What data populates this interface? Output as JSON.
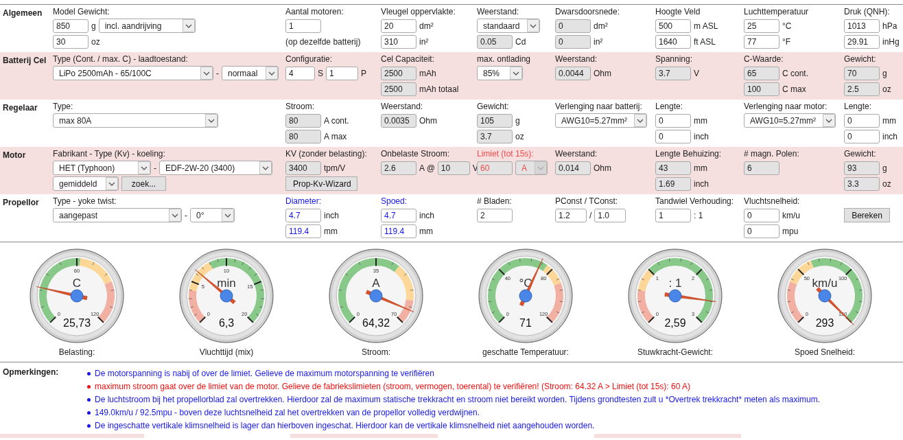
{
  "rows": [
    {
      "title": "Algemeen",
      "highlight": false,
      "cells": [
        {
          "kind": "plain",
          "label": "Model Gewicht:",
          "lines": [
            [
              {
                "kind": "input",
                "value": "850",
                "readonly": false
              },
              {
                "kind": "text",
                "text": "g"
              },
              {
                "kind": "select",
                "value": "incl. aandrijving",
                "disabled": false
              }
            ],
            [
              {
                "kind": "input",
                "value": "30",
                "readonly": false
              },
              {
                "kind": "text",
                "text": "oz"
              }
            ]
          ]
        },
        {
          "kind": "plain",
          "label": "Aantal motoren:",
          "lines": [
            [
              {
                "kind": "input",
                "value": "1",
                "readonly": false
              }
            ],
            [
              {
                "kind": "note",
                "text": "(op dezelfde batterij)"
              }
            ]
          ]
        },
        {
          "kind": "plain",
          "label": "Vleugel oppervlakte:",
          "lines": [
            [
              {
                "kind": "input",
                "value": "20",
                "readonly": false
              },
              {
                "kind": "text",
                "text": "dm²"
              }
            ],
            [
              {
                "kind": "input",
                "value": "310",
                "readonly": false
              },
              {
                "kind": "text",
                "text": "in²"
              }
            ]
          ]
        },
        {
          "kind": "plain",
          "label": "Weerstand:",
          "lines": [
            [
              {
                "kind": "select",
                "value": "standaard",
                "disabled": false
              }
            ],
            [
              {
                "kind": "input",
                "value": "0.05",
                "readonly": true
              },
              {
                "kind": "text",
                "text": "Cd"
              }
            ]
          ]
        },
        {
          "kind": "plain",
          "label": "Dwarsdoorsnede:",
          "lines": [
            [
              {
                "kind": "input",
                "value": "0",
                "readonly": true
              },
              {
                "kind": "text",
                "text": "dm²"
              }
            ],
            [
              {
                "kind": "input",
                "value": "0",
                "readonly": true
              },
              {
                "kind": "text",
                "text": "in²"
              }
            ]
          ]
        },
        {
          "kind": "plain",
          "label": "Hoogte Veld",
          "lines": [
            [
              {
                "kind": "input",
                "value": "500",
                "readonly": false
              },
              {
                "kind": "text",
                "text": "m ASL"
              }
            ],
            [
              {
                "kind": "input",
                "value": "1640",
                "readonly": false
              },
              {
                "kind": "text",
                "text": "ft ASL"
              }
            ]
          ]
        },
        {
          "kind": "plain",
          "label": "Luchttemperatuur",
          "lines": [
            [
              {
                "kind": "input",
                "value": "25",
                "readonly": false
              },
              {
                "kind": "text",
                "text": "°C"
              }
            ],
            [
              {
                "kind": "input",
                "value": "77",
                "readonly": false
              },
              {
                "kind": "text",
                "text": "°F"
              }
            ]
          ]
        },
        {
          "kind": "plain",
          "label": "Druk (QNH):",
          "lines": [
            [
              {
                "kind": "input",
                "value": "1013",
                "readonly": false
              },
              {
                "kind": "text",
                "text": "hPa"
              }
            ],
            [
              {
                "kind": "input",
                "value": "29.91",
                "readonly": false
              },
              {
                "kind": "text",
                "text": "inHg"
              }
            ]
          ]
        }
      ]
    },
    {
      "title": "Batterij Cel",
      "highlight": true,
      "cells": [
        {
          "kind": "plain",
          "label": "Type (Cont. / max. C) - laadtoestand:",
          "lines": [
            [
              {
                "kind": "select",
                "value": "LiPo 2500mAh - 65/100C",
                "disabled": false
              },
              {
                "kind": "text",
                "text": "-"
              },
              {
                "kind": "select",
                "value": "normaal",
                "disabled": false
              }
            ]
          ]
        },
        {
          "kind": "plain",
          "label": "Configuratie:",
          "lines": [
            [
              {
                "kind": "input",
                "value": "4",
                "readonly": false
              },
              {
                "kind": "text",
                "text": "S"
              },
              {
                "kind": "input",
                "value": "1",
                "readonly": false
              },
              {
                "kind": "text",
                "text": "P"
              }
            ]
          ]
        },
        {
          "kind": "plain",
          "label": "Cel Capaciteit:",
          "lines": [
            [
              {
                "kind": "input",
                "value": "2500",
                "readonly": true
              },
              {
                "kind": "text",
                "text": "mAh"
              }
            ],
            [
              {
                "kind": "input",
                "value": "2500",
                "readonly": true
              },
              {
                "kind": "text",
                "text": "mAh totaal"
              }
            ]
          ]
        },
        {
          "kind": "plain",
          "label": "max. ontlading",
          "lines": [
            [
              {
                "kind": "select",
                "value": "85%",
                "disabled": false
              }
            ]
          ]
        },
        {
          "kind": "plain",
          "label": "Weerstand:",
          "lines": [
            [
              {
                "kind": "input",
                "value": "0.0044",
                "readonly": true
              },
              {
                "kind": "text",
                "text": "Ohm"
              }
            ]
          ]
        },
        {
          "kind": "plain",
          "label": "Spanning:",
          "lines": [
            [
              {
                "kind": "input",
                "value": "3.7",
                "readonly": true
              },
              {
                "kind": "text",
                "text": "V"
              }
            ]
          ]
        },
        {
          "kind": "plain",
          "label": "C-Waarde:",
          "lines": [
            [
              {
                "kind": "input",
                "value": "65",
                "readonly": true
              },
              {
                "kind": "text",
                "text": "C cont."
              }
            ],
            [
              {
                "kind": "input",
                "value": "100",
                "readonly": true
              },
              {
                "kind": "text",
                "text": "C max"
              }
            ]
          ]
        },
        {
          "kind": "plain",
          "label": "Gewicht:",
          "lines": [
            [
              {
                "kind": "input",
                "value": "70",
                "readonly": true
              },
              {
                "kind": "text",
                "text": "g"
              }
            ],
            [
              {
                "kind": "input",
                "value": "2.5",
                "readonly": true
              },
              {
                "kind": "text",
                "text": "oz"
              }
            ]
          ]
        }
      ]
    },
    {
      "title": "Regelaar",
      "highlight": false,
      "cells": [
        {
          "kind": "plain",
          "label": "Type:",
          "lines": [
            [
              {
                "kind": "select",
                "value": "max 80A",
                "disabled": false
              }
            ]
          ]
        },
        {
          "kind": "plain",
          "label": "Stroom:",
          "lines": [
            [
              {
                "kind": "input",
                "value": "80",
                "readonly": true
              },
              {
                "kind": "text",
                "text": "A cont."
              }
            ],
            [
              {
                "kind": "input",
                "value": "80",
                "readonly": true
              },
              {
                "kind": "text",
                "text": "A max"
              }
            ]
          ]
        },
        {
          "kind": "plain",
          "label": "Weerstand:",
          "lines": [
            [
              {
                "kind": "input",
                "value": "0.0035",
                "readonly": true
              },
              {
                "kind": "text",
                "text": "Ohm"
              }
            ]
          ]
        },
        {
          "kind": "plain",
          "label": "Gewicht:",
          "lines": [
            [
              {
                "kind": "input",
                "value": "105",
                "readonly": true
              },
              {
                "kind": "text",
                "text": "g"
              }
            ],
            [
              {
                "kind": "input",
                "value": "3.7",
                "readonly": true
              },
              {
                "kind": "text",
                "text": "oz"
              }
            ]
          ]
        },
        {
          "kind": "plain",
          "label": "Verlenging naar batterij:",
          "lines": [
            [
              {
                "kind": "select",
                "value": "AWG10=5.27mm²",
                "disabled": false
              }
            ]
          ]
        },
        {
          "kind": "plain",
          "label": "Lengte:",
          "lines": [
            [
              {
                "kind": "input",
                "value": "0",
                "readonly": false
              },
              {
                "kind": "text",
                "text": "mm"
              }
            ],
            [
              {
                "kind": "input",
                "value": "0",
                "readonly": false
              },
              {
                "kind": "text",
                "text": "inch"
              }
            ]
          ]
        },
        {
          "kind": "plain",
          "label": "Verlenging naar motor:",
          "lines": [
            [
              {
                "kind": "select",
                "value": "AWG10=5.27mm²",
                "disabled": false
              }
            ]
          ]
        },
        {
          "kind": "plain",
          "label": "Lengte:",
          "lines": [
            [
              {
                "kind": "input",
                "value": "0",
                "readonly": false
              },
              {
                "kind": "text",
                "text": "mm"
              }
            ],
            [
              {
                "kind": "input",
                "value": "0",
                "readonly": false
              },
              {
                "kind": "text",
                "text": "inch"
              }
            ]
          ]
        }
      ]
    },
    {
      "title": "Motor",
      "highlight": true,
      "cells": [
        {
          "kind": "plain",
          "label": "Fabrikant - Type (Kv) - koeling:",
          "lines": [
            [
              {
                "kind": "select",
                "value": "HET (Typhoon)",
                "disabled": false
              },
              {
                "kind": "text",
                "text": "-"
              },
              {
                "kind": "select",
                "value": "EDF-2W-20 (3400)",
                "disabled": false
              }
            ],
            [
              {
                "kind": "select",
                "value": "gemiddeld",
                "disabled": false
              },
              {
                "kind": "button",
                "text": "zoek..."
              }
            ]
          ]
        },
        {
          "kind": "plain",
          "label": "KV (zonder belasting):",
          "lines": [
            [
              {
                "kind": "input",
                "value": "3400",
                "readonly": true
              },
              {
                "kind": "text",
                "text": "tpm/V"
              }
            ],
            [
              {
                "kind": "button",
                "text": "Prop-Kv-Wizard"
              }
            ]
          ]
        },
        {
          "kind": "plain",
          "label": "Onbelaste Stroom:",
          "lines": [
            [
              {
                "kind": "input",
                "value": "2.6",
                "readonly": true
              },
              {
                "kind": "text",
                "text": "A @"
              },
              {
                "kind": "input",
                "value": "10",
                "readonly": true
              },
              {
                "kind": "text",
                "text": "V"
              }
            ]
          ]
        },
        {
          "kind": "alert",
          "label": "Limiet (tot 15s):",
          "lines": [
            [
              {
                "kind": "input",
                "value": "60",
                "readonly": true
              },
              {
                "kind": "select",
                "value": "A",
                "disabled": true
              }
            ]
          ]
        },
        {
          "kind": "plain",
          "label": "Weerstand:",
          "lines": [
            [
              {
                "kind": "input",
                "value": "0.014",
                "readonly": true
              },
              {
                "kind": "text",
                "text": "Ohm"
              }
            ]
          ]
        },
        {
          "kind": "plain",
          "label": "Lengte Behuizing:",
          "lines": [
            [
              {
                "kind": "input",
                "value": "43",
                "readonly": true
              },
              {
                "kind": "text",
                "text": "mm"
              }
            ],
            [
              {
                "kind": "input",
                "value": "1.69",
                "readonly": true
              },
              {
                "kind": "text",
                "text": "inch"
              }
            ]
          ]
        },
        {
          "kind": "plain",
          "label": "# magn. Polen:",
          "lines": [
            [
              {
                "kind": "input",
                "value": "6",
                "readonly": true
              }
            ]
          ]
        },
        {
          "kind": "plain",
          "label": "Gewicht:",
          "lines": [
            [
              {
                "kind": "input",
                "value": "93",
                "readonly": true
              },
              {
                "kind": "text",
                "text": "g"
              }
            ],
            [
              {
                "kind": "input",
                "value": "3.3",
                "readonly": true
              },
              {
                "kind": "text",
                "text": "oz"
              }
            ]
          ]
        }
      ]
    },
    {
      "title": "Propellor",
      "highlight": false,
      "cells": [
        {
          "kind": "plain",
          "label": "Type - yoke twist:",
          "lines": [
            [
              {
                "kind": "select",
                "value": "aangepast",
                "disabled": false
              },
              {
                "kind": "text",
                "text": "-"
              },
              {
                "kind": "select",
                "value": "0°",
                "disabled": false
              }
            ]
          ]
        },
        {
          "kind": "link",
          "label": "Diameter:",
          "lines": [
            [
              {
                "kind": "input",
                "value": "4.7",
                "readonly": false
              },
              {
                "kind": "text",
                "text": "inch"
              }
            ],
            [
              {
                "kind": "input",
                "value": "119.4",
                "readonly": false
              },
              {
                "kind": "text",
                "text": "mm"
              }
            ]
          ]
        },
        {
          "kind": "link",
          "label": "Spoed:",
          "lines": [
            [
              {
                "kind": "input",
                "value": "4.7",
                "readonly": false
              },
              {
                "kind": "text",
                "text": "inch"
              }
            ],
            [
              {
                "kind": "input",
                "value": "119.4",
                "readonly": false
              },
              {
                "kind": "text",
                "text": "mm"
              }
            ]
          ]
        },
        {
          "kind": "plain",
          "label": "# Bladen:",
          "lines": [
            [
              {
                "kind": "input",
                "value": "2",
                "readonly": false
              }
            ]
          ]
        },
        {
          "kind": "plain",
          "label": "PConst / TConst:",
          "lines": [
            [
              {
                "kind": "input",
                "value": "1.2",
                "readonly": false
              },
              {
                "kind": "text",
                "text": "/"
              },
              {
                "kind": "input",
                "value": "1.0",
                "readonly": false
              }
            ]
          ]
        },
        {
          "kind": "plain",
          "label": "Tandwiel Verhouding:",
          "lines": [
            [
              {
                "kind": "input",
                "value": "1",
                "readonly": false
              },
              {
                "kind": "text",
                "text": ": 1"
              }
            ]
          ]
        },
        {
          "kind": "plain",
          "label": "Vluchtsnelheid:",
          "lines": [
            [
              {
                "kind": "input",
                "value": "0",
                "readonly": false
              },
              {
                "kind": "text",
                "text": "km/u"
              }
            ],
            [
              {
                "kind": "input",
                "value": "0",
                "readonly": false
              },
              {
                "kind": "text",
                "text": "mpu"
              }
            ]
          ]
        },
        {
          "kind": "plain",
          "lines": [
            [
              {
                "kind": "button",
                "text": "Bereken"
              }
            ]
          ]
        }
      ]
    }
  ],
  "gauges": [
    {
      "unit": "C",
      "reading": "25,73",
      "label": "Belasting:",
      "ticks": [
        "60",
        "0",
        "120"
      ]
    },
    {
      "unit": "min",
      "reading": "6,3",
      "label": "Vluchttijd (mix)",
      "ticks": [
        "10",
        "5",
        "15",
        "0",
        "20"
      ]
    },
    {
      "unit": "A",
      "reading": "64,32",
      "label": "Stroom:",
      "ticks": [
        "35",
        "0",
        "70"
      ]
    },
    {
      "unit": "°C",
      "reading": "71",
      "label": "geschatte Temperatuur:",
      "ticks": [
        "40",
        "80",
        "0",
        "120"
      ]
    },
    {
      "unit": ": 1",
      "reading": "2,59",
      "label": "Stuwkracht-Gewicht:",
      "ticks": [
        "1",
        "2",
        "0",
        "3"
      ]
    },
    {
      "unit": "km/u",
      "reading": "293",
      "label": "Spoed Snelheid:",
      "ticks": [
        "50",
        "100",
        "0",
        "150"
      ]
    }
  ],
  "remarks": {
    "title": "Opmerkingen:",
    "items": [
      {
        "color": "#1818e8",
        "text": "De motorspanning is nabij of over de limiet. Gelieve de maximum motorspanning te verifiëren"
      },
      {
        "color": "#f01010",
        "text": "maximum stroom gaat over de limiet van de motor. Gelieve de fabriekslimieten (stroom, vermogen, toerental) te verifiëren! (Stroom: 64.32 A > Limiet (tot 15s): 60 A)"
      },
      {
        "color": "#1818e8",
        "text": "De luchtstroom bij het propellorblad zal overtrekken. Hierdoor zal de maximum statische trekkracht en stroom niet bereikt worden. Tijdens grondtesten zult u *Overtrek trekkracht* meten als maximum."
      },
      {
        "color": "#1818e8",
        "text": "149.0km/u / 92.5mpu - boven deze luchtsnelheid zal het overtrekken van de propellor volledig verdwijnen."
      },
      {
        "color": "#1818e8",
        "text": "De ingeschatte vertikale klimsnelheid is lager dan hierboven ingeschat. Hierdoor kan de vertikale klimsnelheid niet aangehouden worden."
      }
    ]
  }
}
